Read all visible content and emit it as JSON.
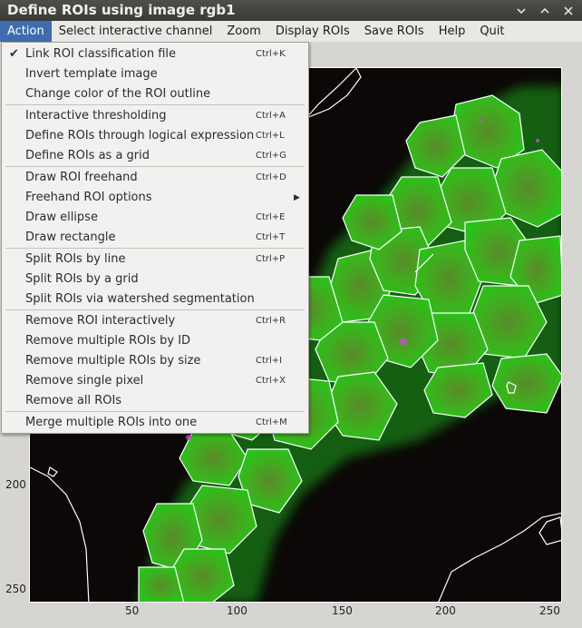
{
  "window": {
    "title": "Define ROIs using image rgb1",
    "controls": [
      "chevron-down",
      "chevron-up",
      "close"
    ]
  },
  "menubar": [
    {
      "label": "Action",
      "active": true
    },
    {
      "label": "Select interactive channel",
      "active": false
    },
    {
      "label": "Zoom",
      "active": false
    },
    {
      "label": "Display ROIs",
      "active": false
    },
    {
      "label": "Save ROIs",
      "active": false
    },
    {
      "label": "Help",
      "active": false
    },
    {
      "label": "Quit",
      "active": false
    }
  ],
  "action_menu": {
    "groups": [
      [
        {
          "label": "Link ROI classification file",
          "accel": "Ctrl+K",
          "checked": true
        },
        {
          "label": "Invert template image",
          "accel": ""
        },
        {
          "label": "Change color of the ROI outline",
          "accel": ""
        }
      ],
      [
        {
          "label": "Interactive thresholding",
          "accel": "Ctrl+A"
        },
        {
          "label": "Define ROIs through logical expression",
          "accel": "Ctrl+L"
        },
        {
          "label": "Define ROIs as a grid",
          "accel": "Ctrl+G"
        }
      ],
      [
        {
          "label": "Draw ROI freehand",
          "accel": "Ctrl+D"
        },
        {
          "label": "Freehand ROI options",
          "accel": "",
          "submenu": true
        },
        {
          "label": "Draw ellipse",
          "accel": "Ctrl+E"
        },
        {
          "label": "Draw rectangle",
          "accel": "Ctrl+T"
        }
      ],
      [
        {
          "label": "Split ROIs by line",
          "accel": "Ctrl+P"
        },
        {
          "label": "Split ROIs by a grid",
          "accel": ""
        },
        {
          "label": "Split ROIs via watershed segmentation",
          "accel": ""
        }
      ],
      [
        {
          "label": "Remove ROI interactively",
          "accel": "Ctrl+R"
        },
        {
          "label": "Remove multiple ROIs by ID",
          "accel": ""
        },
        {
          "label": "Remove multiple ROIs by size",
          "accel": "Ctrl+I"
        },
        {
          "label": "Remove single pixel",
          "accel": "Ctrl+X"
        },
        {
          "label": "Remove all ROIs",
          "accel": ""
        }
      ],
      [
        {
          "label": "Merge multiple ROIs into one",
          "accel": "Ctrl+M"
        }
      ]
    ]
  },
  "image_view": {
    "x_ticks": [
      "50",
      "100",
      "150",
      "200",
      "250"
    ],
    "y_ticks": [
      "200",
      "250"
    ],
    "roi_outline_color": "#ffffff",
    "background_color": "#0b0807"
  }
}
